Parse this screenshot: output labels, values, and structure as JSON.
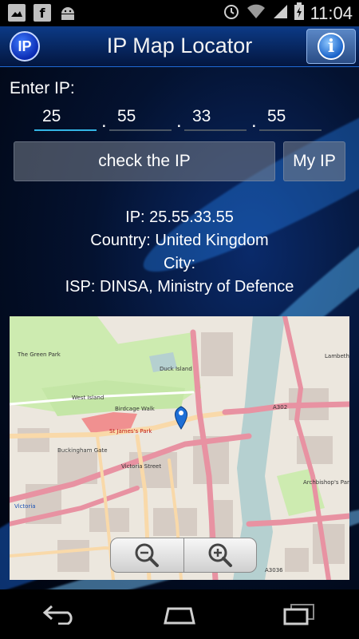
{
  "status_bar": {
    "time": "11:04",
    "left_icons": [
      "image-icon",
      "facebook-icon",
      "android-icon"
    ],
    "right_icons": [
      "alarm-icon",
      "wifi-icon",
      "signal-icon",
      "battery-icon"
    ]
  },
  "app": {
    "title": "IP Map Locator",
    "logo_text": "IP",
    "info_icon": "i"
  },
  "form": {
    "enter_label": "Enter IP:",
    "octets": [
      "25",
      "55",
      "33",
      "55"
    ],
    "separator": ".",
    "check_button": "check the IP",
    "myip_button": "My IP"
  },
  "result": {
    "ip_line": "IP: 25.55.33.55",
    "country_line": "Country: United Kingdom",
    "city_line": "City:",
    "isp_line": "ISP: DINSA, Ministry of Defence"
  },
  "map": {
    "labels": {
      "the_green": "The Green Park",
      "west_island": "West Island",
      "duck_island": "Duck Island",
      "birdcage_walk": "Birdcage Walk",
      "st_james_park": "St James's Park",
      "victoria": "Victoria",
      "victoria_street": "Victoria Street",
      "lambeth": "Lambeth",
      "a302": "A302",
      "a3036": "A3036",
      "archbishop": "Archbishop's Park",
      "buckingham_gate": "Buckingham Gate"
    },
    "zoom_out_icon": "zoom-out-icon",
    "zoom_in_icon": "zoom-in-icon",
    "colors": {
      "park": "#cdebb0",
      "water": "#b5d0d0",
      "road_major": "#e892a2",
      "road_secondary": "#f9d9a9",
      "building": "#d9d0c9",
      "marker": "#1d6fd6"
    }
  },
  "nav_bar": {
    "icons": [
      "back-icon",
      "home-icon",
      "recent-apps-icon"
    ]
  }
}
